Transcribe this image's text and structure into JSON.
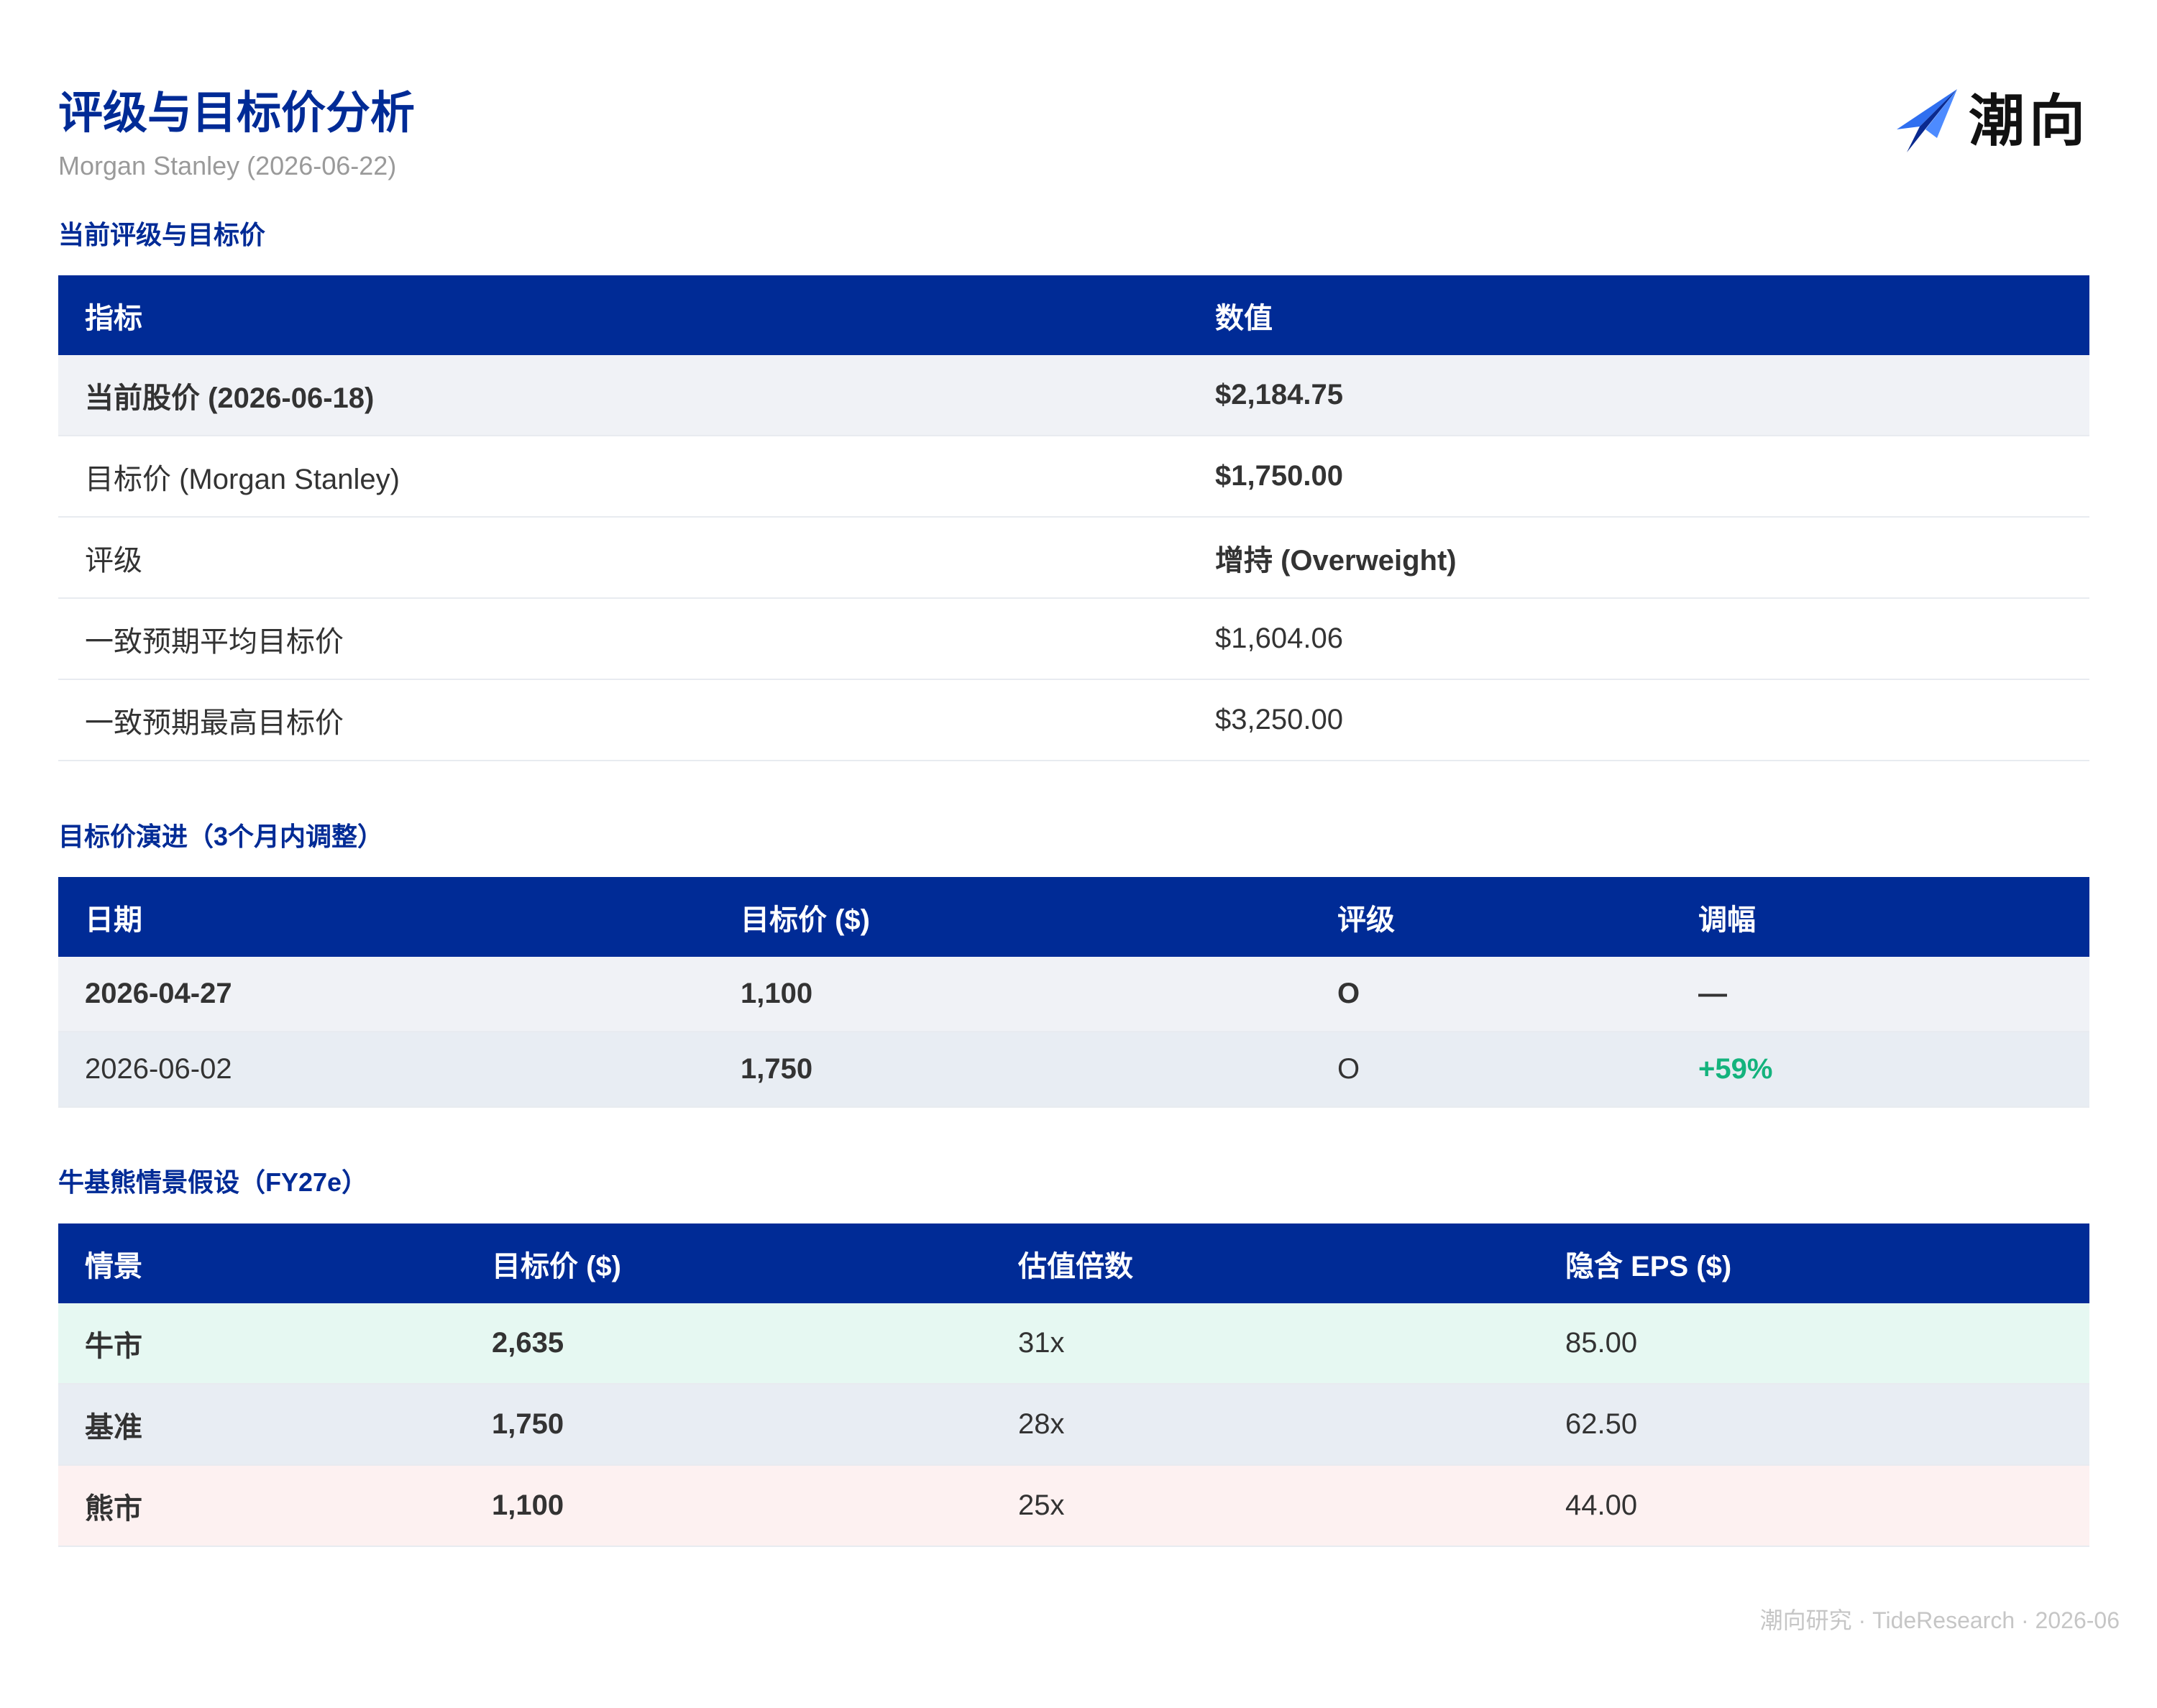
{
  "header": {
    "title": "评级与目标价分析",
    "subtitle": "Morgan Stanley (2026-06-22)"
  },
  "logo": {
    "icon": "paper-plane-arrow-icon",
    "text": "潮向",
    "colors": [
      "#2f6ff0",
      "#0a2a8f"
    ]
  },
  "colors": {
    "primary": "#002b96",
    "positive": "#14b37d",
    "bull_row": "#e6f8f2",
    "base_row": "#e8edf3",
    "bear_row": "#fdf1f1"
  },
  "sections": {
    "current": {
      "title": "当前评级与目标价",
      "headers": [
        "指标",
        "数值"
      ],
      "rows": [
        {
          "label": "当前股价 (2026-06-18)",
          "value": "$2,184.75"
        },
        {
          "label": "目标价 (Morgan Stanley)",
          "value": "$1,750.00"
        },
        {
          "label": "评级",
          "value": "增持 (Overweight)"
        },
        {
          "label": "一致预期平均目标价",
          "value": "$1,604.06"
        },
        {
          "label": "一致预期最高目标价",
          "value": "$3,250.00"
        }
      ]
    },
    "evolution": {
      "title": "目标价演进（3个月内调整）",
      "headers": [
        "日期",
        "目标价 ($)",
        "评级",
        "调幅"
      ],
      "rows": [
        {
          "date": "2026-04-27",
          "target": "1,100",
          "rating": "O",
          "change": "—"
        },
        {
          "date": "2026-06-02",
          "target": "1,750",
          "rating": "O",
          "change": "+59%"
        }
      ]
    },
    "scenarios": {
      "title": "牛基熊情景假设（FY27e）",
      "headers": [
        "情景",
        "目标价 ($)",
        "估值倍数",
        "隐含 EPS ($)"
      ],
      "rows": [
        {
          "scenario": "牛市",
          "target": "2,635",
          "multiple": "31x",
          "eps": "85.00"
        },
        {
          "scenario": "基准",
          "target": "1,750",
          "multiple": "28x",
          "eps": "62.50"
        },
        {
          "scenario": "熊市",
          "target": "1,100",
          "multiple": "25x",
          "eps": "44.00"
        }
      ]
    }
  },
  "footer": {
    "text": "潮向研究 · TideResearch · 2026-06"
  }
}
